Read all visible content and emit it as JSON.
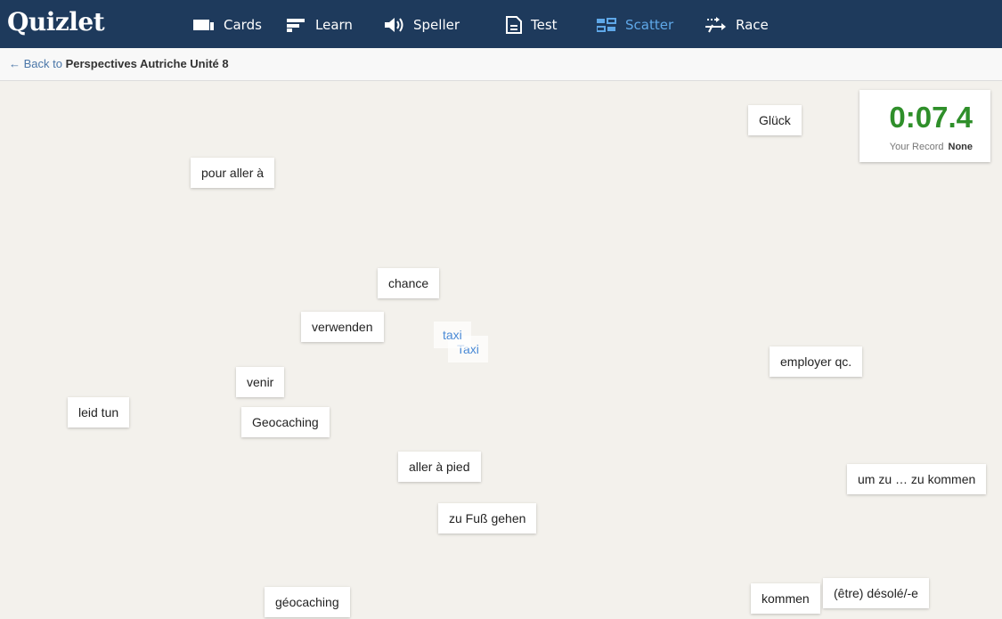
{
  "app": {
    "logo": "Quizlet"
  },
  "nav": {
    "items": [
      {
        "label": "Cards",
        "icon": "cards-icon"
      },
      {
        "label": "Learn",
        "icon": "learn-icon"
      },
      {
        "label": "Speller",
        "icon": "speaker-icon"
      },
      {
        "label": "Test",
        "icon": "test-document-icon"
      },
      {
        "label": "Scatter",
        "icon": "scatter-grid-icon",
        "active": true
      },
      {
        "label": "Race",
        "icon": "race-arrows-icon"
      }
    ]
  },
  "breadcrumb": {
    "back": "← Back to",
    "set_name": "Perspectives Autriche Unité 8"
  },
  "timer": {
    "time": "0:07.4",
    "record_label": "Your Record",
    "record_value": "None"
  },
  "cards": [
    "Glück",
    "pour aller à",
    "chance",
    "verwenden",
    "taxi",
    "Taxi",
    "employer qc.",
    "venir",
    "leid tun",
    "Geocaching",
    "aller à pied",
    "um zu … zu kommen",
    "zu Fuß gehen",
    "géocaching",
    "kommen",
    "(être) désolé/-e"
  ],
  "colors": {
    "nav_bg": "#1e3a5c",
    "active": "#5fa8e8",
    "timer_green": "#2f8f2a",
    "board_bg": "#f3f1ec"
  }
}
